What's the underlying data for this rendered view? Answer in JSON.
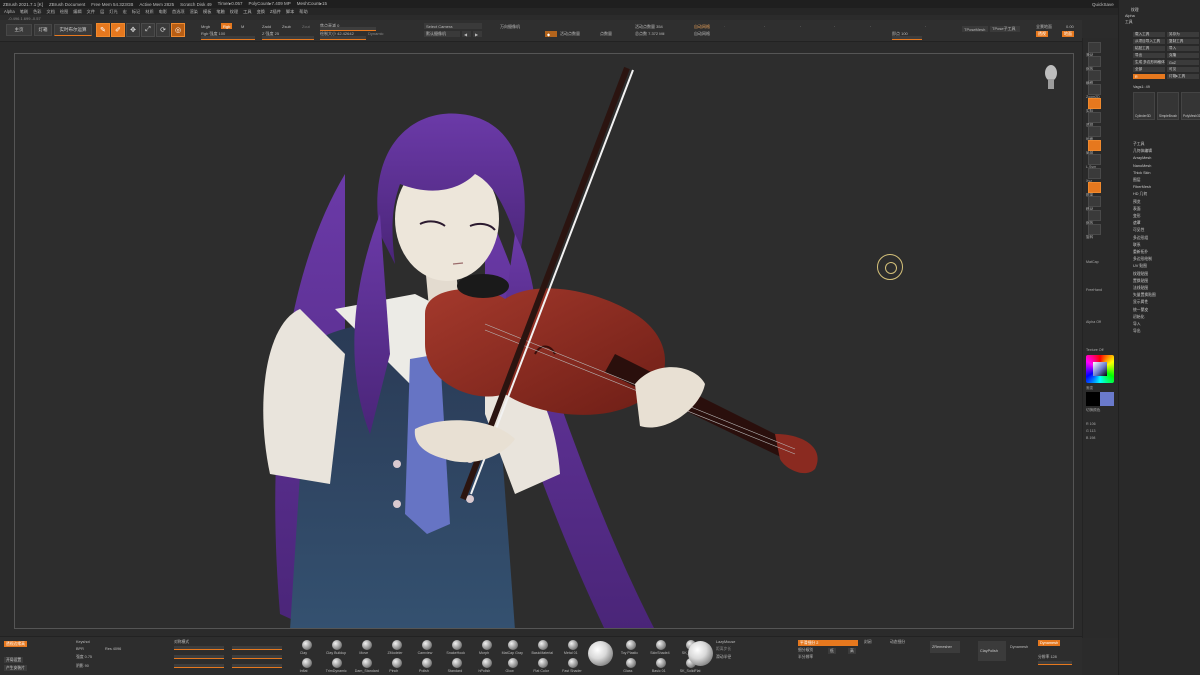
{
  "titlebar": {
    "app": "ZBrush 2021.7.1 [K]",
    "document": "ZBrush Document",
    "free_mem": "Free Mem 54.323GB",
    "active_mem": "Active Mem 2825",
    "scratch_disk": "Scratch Disk 49",
    "timer": "Timer▸0.057",
    "poly_count": "PolyCount▸7.409 MP",
    "mesh_count": "MeshCount▸15",
    "quicksave": "QuickSave",
    "see_through": "透视透明 0",
    "menus_btn": "菜单",
    "default_script": "DefaultZScript"
  },
  "menubar": {
    "items": [
      "Alpha",
      "笔刷",
      "色彩",
      "文档",
      "绘图",
      "编辑",
      "文件",
      "层",
      "灯光",
      "宏",
      "标记",
      "材质",
      "电影",
      "首选项",
      "渲染",
      "模板",
      "笔触",
      "纹理",
      "工具",
      "变换",
      "Z插件",
      "脚本",
      "帮助"
    ]
  },
  "coord_readout": "-0.496,1.699,-0.57",
  "toolbar": {
    "tab_home": "主页",
    "tab_lightbox": "灯箱",
    "tab_preview": "实时布尔运算",
    "tool_edit": "Edit",
    "tool_draw": "Draw",
    "tool_move": "Move",
    "tool_scale": "Scale",
    "tool_rotate": "Rotate",
    "mrgb": "Mrgb",
    "rgb": "Rgb",
    "m": "M",
    "zadd": "Zadd",
    "zsub": "Zsub",
    "zcut": "Zcut",
    "rgb_intensity": "Rgb 强度 100",
    "z_intensity": "Z 强度 25",
    "focal_shift": "焦点衰减 0",
    "draw_size": "绘制大小 42.42642",
    "dynamic": "Dynamic",
    "select_camera": "Select Camera",
    "camera_view": "默认摄像机",
    "camera_universal": "万向摄像机",
    "active_points": "活动点数量",
    "total_points": "点数量",
    "active_points_val": "活动点数量 354",
    "total_points_val": "总点数 7.372 Mil",
    "auto_mesh": "自动网格",
    "tpose_mesh": "TPoseMesh",
    "tpose_sub": "TPose子工具",
    "floor_grid": "全景地面",
    "zoom_val": "即点 100",
    "zero": "0.00",
    "persp": "透视",
    "floor": "地面"
  },
  "rightshelf": {
    "labels": [
      "滑动",
      "缩放",
      "横移",
      "Zoom2D",
      "实际",
      "透视",
      "地面",
      "局部",
      "L.Sym",
      "Xyz",
      "框架",
      "移动",
      "缩放",
      "旋转"
    ],
    "brush_name": "MatCap",
    "stroke_name": "FreeHand",
    "alpha_label": "Alpha Off",
    "texture_label": "Texture Off",
    "gradient_label": "渐变",
    "switch_color": "切换颜色",
    "color_r": "R 106",
    "color_g": "G 113",
    "color_b": "B 198"
  },
  "tray": {
    "title": "工具",
    "subtitle": "Alpha",
    "header": "纹理",
    "buttons": [
      "载入工具",
      "另存为",
      "从项目导入工具",
      "复制工具",
      "粘贴工具",
      "导入",
      "导出",
      "克隆",
      "生成 多边形网格体",
      "GoZ",
      "全部",
      "可见",
      "R",
      "灯箱▸工具"
    ],
    "tool_name": "Vags1: 49",
    "thumbs": [
      "Cylinder3D",
      "SimpleBrush",
      "PolyMesh3D"
    ],
    "subtools": [
      "子工具",
      "几何体编辑",
      "ArrayMesh",
      "NanoMesh",
      "Thick Skin",
      "图层",
      "FiberMesh",
      "HD 几何",
      "预览",
      "表面",
      "变形",
      "遮罩",
      "可见性",
      "多边形组",
      "联系",
      "重新拓扑",
      "多边形绘制",
      "UV 贴图",
      "纹理贴图",
      "置换贴图",
      "法线贴图",
      "矢量置换贴图",
      "显示属性",
      "统一蒙皮",
      "初始化",
      "导入",
      "导出"
    ]
  },
  "bottom": {
    "left_btn_1": "透视边缘高",
    "left_btn_2": "开局设置",
    "left_btn_3": "产生安装片",
    "keyshot": "Keyshot",
    "bpr": "BPR",
    "resolution": "Res 4096",
    "intensity": "强度 0.75",
    "shadow": "阴影 90",
    "sym_label": "对称模式",
    "brushes": [
      "Clay",
      "Clay Buildup",
      "Move",
      "ZModeler",
      "Camview",
      "SnakeHook",
      "Morph",
      "Inflat",
      "TrimDynamic",
      "Dam_Standard",
      "Pinch",
      "Polish",
      "Standard",
      "hPolish"
    ],
    "materials": [
      "MatCap Gray",
      "BasicMaterial",
      "Metal 01",
      "Toy Plastic",
      "SkinShade4",
      "SK_Clay",
      "Glow",
      "Flat Color",
      "Fast Shader",
      "Glass",
      "Basic 01",
      "SK_SolidFlat"
    ],
    "lazy_mouse": "LazyMouse",
    "lazy_step": "距离步长",
    "lazy_radius": "滑动半径",
    "dynamesh": "Dynamesh",
    "dynamesh_res": "分辨率 128",
    "zremesher": "ZRemesher",
    "clay_polish": "ClayPolish",
    "smooth_sub": "平滑细分 2",
    "half": "半分辨率",
    "dynamic_sub": "动态细分",
    "geo_label": "封闭",
    "sub_levels": "细分级别",
    "lower": "低",
    "higher": "高"
  },
  "colors": {
    "accent": "#e6781e",
    "hair": "#5b2f93",
    "violin": "#8a2a20",
    "skin": "#e9e1d5",
    "uniform": "#2c3a52",
    "tie": "#6674c4",
    "secondary_color": "#6a7acb"
  }
}
